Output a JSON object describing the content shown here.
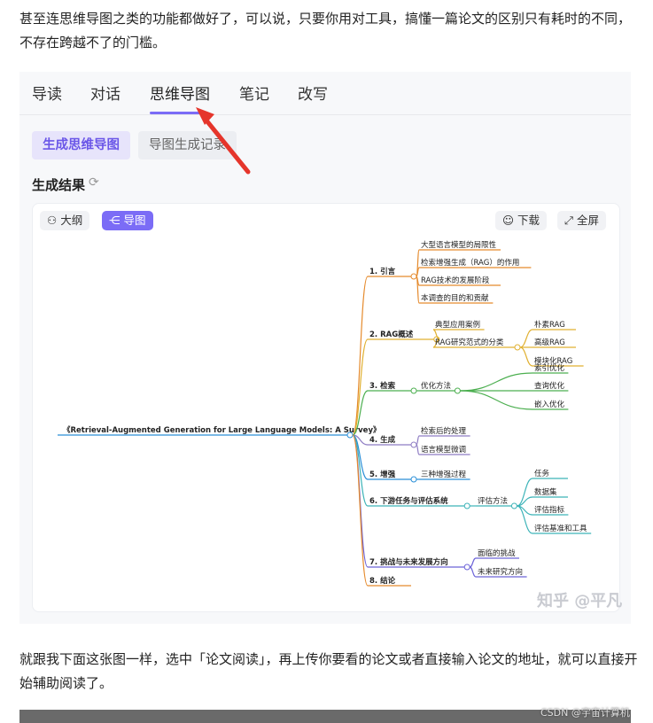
{
  "article": {
    "para1": "甚至连思维导图之类的功能都做好了，可以说，只要你用对工具，搞懂一篇论文的区别只有耗时的不同，不存在跨越不了的门槛。",
    "para2": "就跟我下面这张图一样，选中「论文阅读」，再上传你要看的论文或者直接输入论文的地址，就可以直接开始辅助阅读了。"
  },
  "screenshot": {
    "tabs": [
      "导读",
      "对话",
      "思维导图",
      "笔记",
      "改写"
    ],
    "active_tab": "思维导图",
    "pill_generate": "生成思维导图",
    "pill_records": "导图生成记录",
    "result_title": "生成结果",
    "refresh_icon": "⟳",
    "btn_outline": "大纲",
    "btn_map": "导图",
    "btn_download": "下载",
    "btn_fullscreen": "全屏",
    "accent_color": "#7b6cf6",
    "arrow_color": "#e5352b",
    "watermark": "知乎 @平凡"
  },
  "mindmap": {
    "root": "《Retrieval-Augmented Generation for Large Language Models: A Survey》",
    "branches": [
      {
        "label": "1. 引言",
        "color": "#e58a2c",
        "children": [
          {
            "label": "大型语言模型的局限性",
            "children": []
          },
          {
            "label": "检索增强生成（RAG）的作用",
            "children": []
          },
          {
            "label": "RAG技术的发展阶段",
            "children": []
          },
          {
            "label": "本调查的目的和贡献",
            "children": []
          }
        ]
      },
      {
        "label": "2. RAG概述",
        "color": "#e0b030",
        "children": [
          {
            "label": "典型应用案例",
            "children": []
          },
          {
            "label": "RAG研究范式的分类",
            "children": [
              "朴素RAG",
              "高级RAG",
              "模块化RAG"
            ]
          }
        ]
      },
      {
        "label": "3. 检索",
        "color": "#4caf50",
        "children": [
          {
            "label": "优化方法",
            "children": [
              "索引优化",
              "查询优化",
              "嵌入优化"
            ]
          }
        ]
      },
      {
        "label": "4. 生成",
        "color": "#8e7cc3",
        "children": [
          {
            "label": "检索后的处理",
            "children": []
          },
          {
            "label": "语言模型微调",
            "children": []
          }
        ]
      },
      {
        "label": "5. 增强",
        "color": "#2a8fd8",
        "children": [
          {
            "label": "三种增强过程",
            "children": []
          }
        ]
      },
      {
        "label": "6. 下游任务与评估系统",
        "color": "#3cb3b8",
        "children": [
          {
            "label": "评估方法",
            "children": [
              "任务",
              "数据集",
              "评估指标",
              "评估基准和工具"
            ]
          }
        ]
      },
      {
        "label": "7. 挑战与未来发展方向",
        "color": "#6c63d8",
        "children": [
          {
            "label": "面临的挑战",
            "children": []
          },
          {
            "label": "未来研究方向",
            "children": []
          }
        ]
      },
      {
        "label": "8. 结论",
        "color": "#e58a2c",
        "children": []
      }
    ]
  },
  "footer": {
    "csdn_credit": "CSDN @宇宙计算机"
  }
}
